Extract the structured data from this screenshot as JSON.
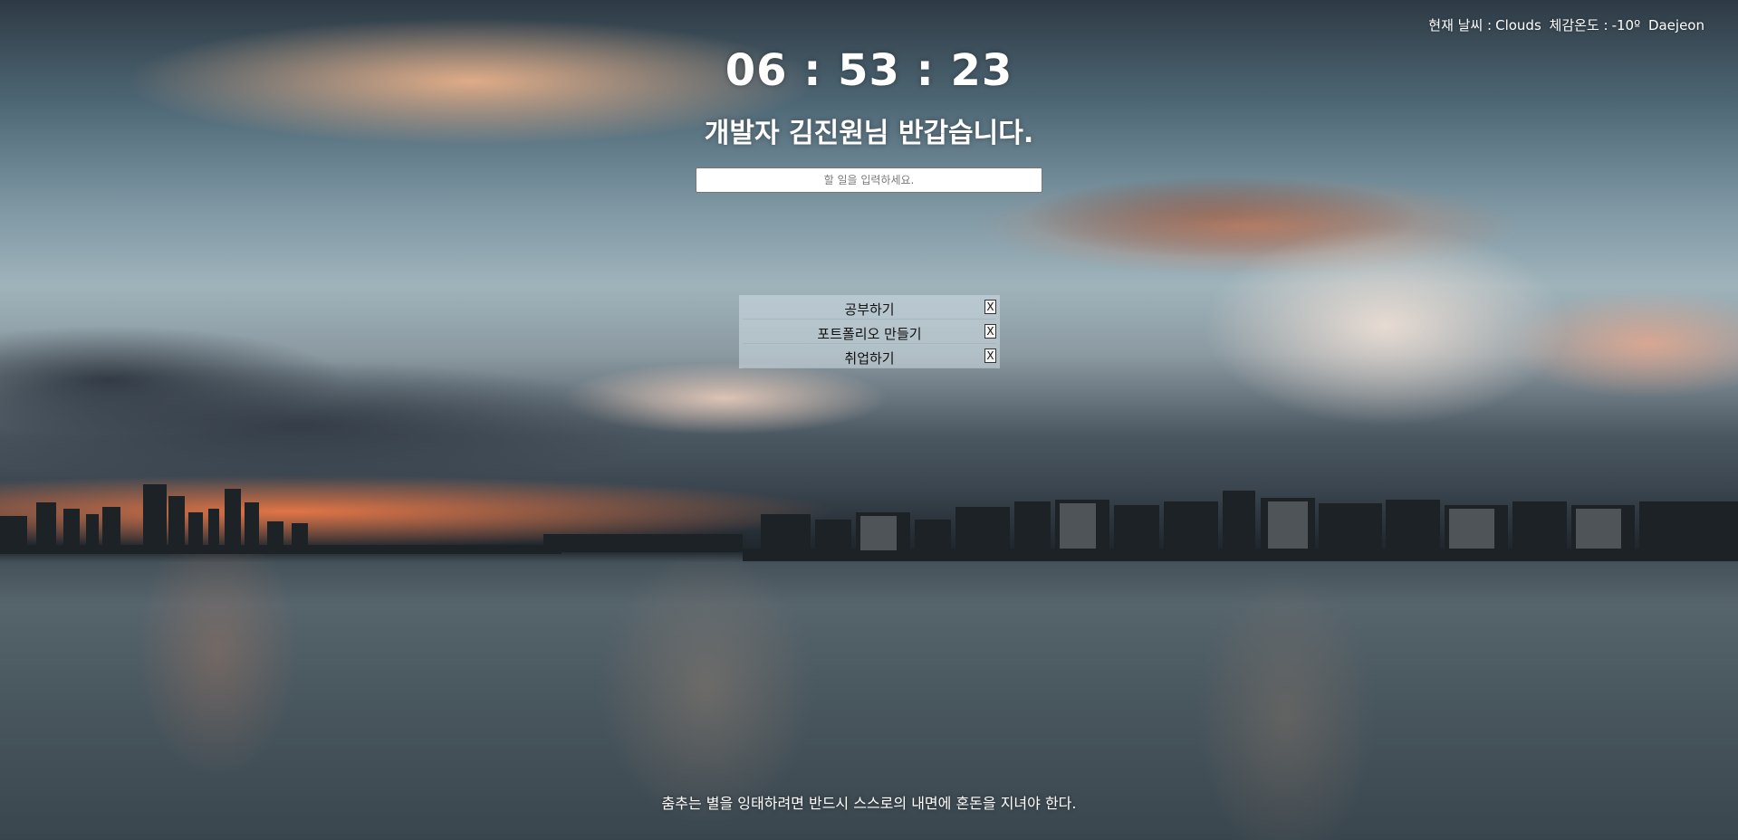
{
  "weather": {
    "label": "현재 날씨 :",
    "condition": "Clouds",
    "feels_like_label": "체감온도 :",
    "feels_like": "-10º",
    "city": "Daejeon"
  },
  "clock": {
    "time": "06 : 53 : 23"
  },
  "greeting": {
    "text": "개발자 김진원님 반갑습니다."
  },
  "todo": {
    "placeholder": "할 일을 입력하세요.",
    "delete_label": "X",
    "items": [
      {
        "label": "공부하기"
      },
      {
        "label": "포트폴리오 만들기"
      },
      {
        "label": "취업하기"
      }
    ]
  },
  "quote": {
    "text": "춤추는 별을 잉태하려면 반드시 스스로의 내면에 혼돈을 지녀야 한다."
  }
}
